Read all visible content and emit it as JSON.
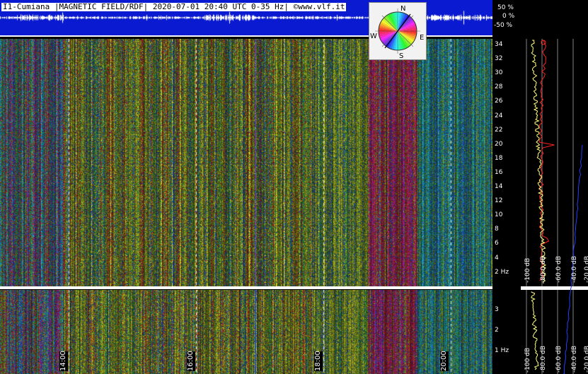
{
  "header": {
    "title": "I1-Cumiana |MAGNETIC FIELD/RDF| 2020-07-01 20:40 UTC 0-35 Hz| ©www.vlf.it"
  },
  "amplitude_scale": {
    "labels": [
      "50 %",
      "0 %",
      "-50 %"
    ]
  },
  "compass": {
    "north": "N",
    "east": "E",
    "south": "S",
    "west": "W"
  },
  "spectrogram_top": {
    "y_ticks": [
      "34",
      "32",
      "30",
      "28",
      "26",
      "24",
      "22",
      "20",
      "18",
      "16",
      "14",
      "12",
      "10",
      "8",
      "6",
      "4",
      "2 Hz"
    ],
    "y_range_hz": [
      0,
      35
    ]
  },
  "spectrogram_bottom": {
    "y_ticks": [
      "3",
      "2",
      "1 Hz"
    ],
    "y_range_hz": [
      0,
      4
    ]
  },
  "time_axis": {
    "labels": [
      "14:00",
      "16:00",
      "18:00",
      "20:00"
    ]
  },
  "profile_panel": {
    "db_labels_top": [
      "-100 dB",
      "-80.0 dB",
      "-60.0 dB",
      "-40.0 dB",
      "-20.0 dB"
    ],
    "db_labels_bottom": [
      "-100 dB",
      "-80.0 dB",
      "-60.0 dB",
      "-40.0 dB",
      "-20.0 dB"
    ]
  },
  "colors": {
    "strip_bg": "#0a1ad0",
    "profile_avg": "#ffff80",
    "profile_peak": "#ff2020",
    "profile_noise": "#2040ff"
  }
}
